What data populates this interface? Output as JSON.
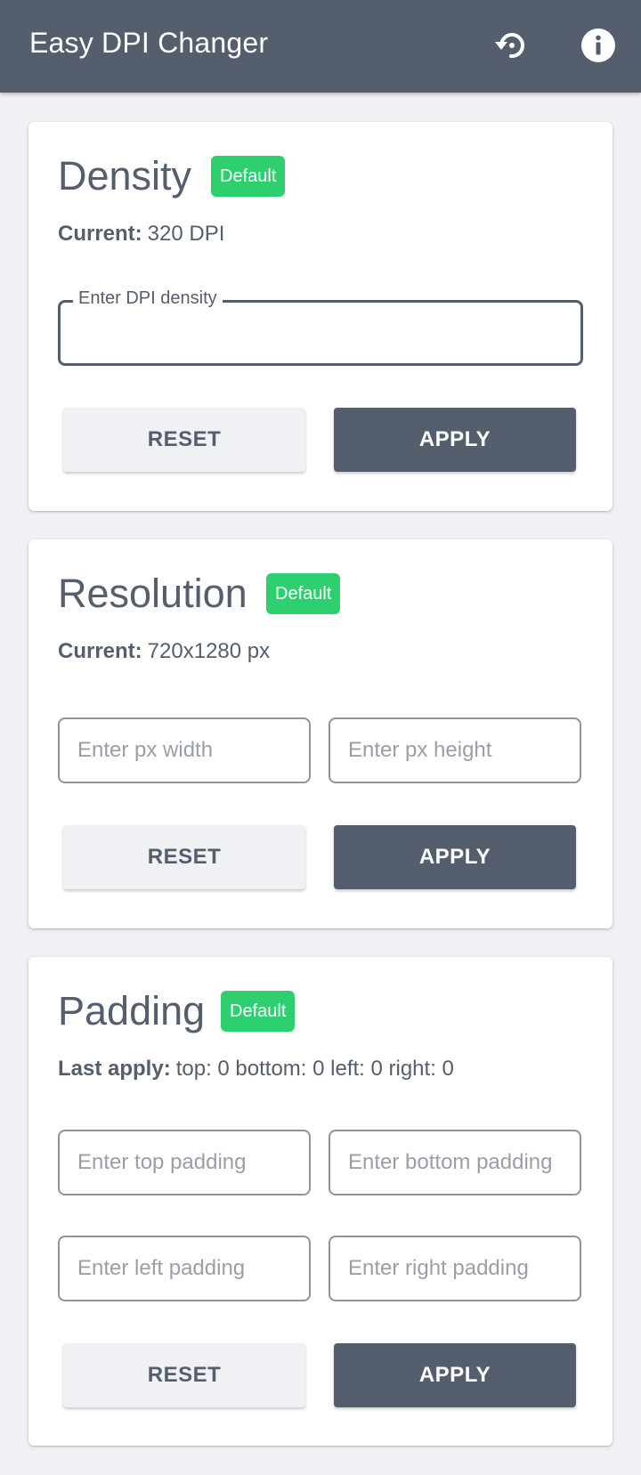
{
  "app": {
    "title": "Easy DPI Changer",
    "icons": {
      "restore": "restore-icon",
      "info": "info-icon"
    },
    "colors": {
      "primary": "#555e6d",
      "accent": "#2ecf6f",
      "background": "#eff1f4"
    }
  },
  "density": {
    "title": "Density",
    "badge": "Default",
    "current_label": "Current:",
    "current_value": "320 DPI",
    "input_label": "Enter DPI density",
    "input_value": "",
    "reset_label": "RESET",
    "apply_label": "APPLY"
  },
  "resolution": {
    "title": "Resolution",
    "badge": "Default",
    "current_label": "Current:",
    "current_value": "720x1280 px",
    "width_placeholder": "Enter px width",
    "height_placeholder": "Enter px height",
    "reset_label": "RESET",
    "apply_label": "APPLY"
  },
  "padding": {
    "title": "Padding",
    "badge": "Default",
    "last_label": "Last apply:",
    "last_value": "top: 0 bottom: 0 left: 0 right: 0",
    "top_placeholder": "Enter top padding",
    "bottom_placeholder": "Enter bottom padding",
    "left_placeholder": "Enter left padding",
    "right_placeholder": "Enter right padding",
    "reset_label": "RESET",
    "apply_label": "APPLY"
  }
}
